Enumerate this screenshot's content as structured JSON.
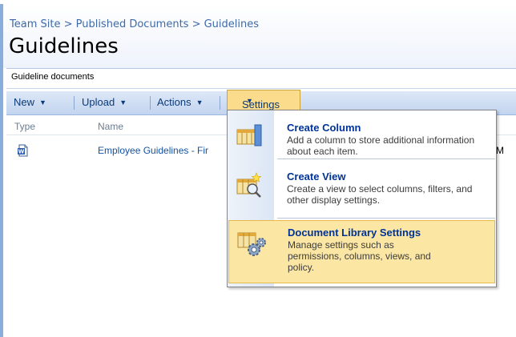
{
  "breadcrumb": {
    "text": "Team Site > Published Documents > Guidelines"
  },
  "page": {
    "title": "Guidelines"
  },
  "webpart": {
    "title": "Guideline documents"
  },
  "toolbar": {
    "new_label": "New",
    "upload_label": "Upload",
    "actions_label": "Actions",
    "settings_label": "Settings",
    "dropdown_arrow": "▼"
  },
  "list": {
    "columns": [
      "Type",
      "Name"
    ],
    "rows": [
      {
        "type_icon": "word-document-icon",
        "name": "Employee Guidelines - Fir",
        "tail": "M"
      }
    ]
  },
  "settings_menu": {
    "items": [
      {
        "title": "Create Column",
        "description": "Add a column to store additional information about each item.",
        "icon": "create-column-icon"
      },
      {
        "title": "Create View",
        "description": "Create a view to select columns, filters, and other display settings.",
        "icon": "create-view-icon"
      },
      {
        "title": "Document Library Settings",
        "description": "Manage settings such as permissions, columns, views, and policy.",
        "icon": "library-settings-icon"
      }
    ]
  },
  "colors": {
    "link": "#1552a0",
    "menu_title": "#003399",
    "highlight": "#fbe6a4",
    "toolbar_bg": "#c2d4ef"
  }
}
